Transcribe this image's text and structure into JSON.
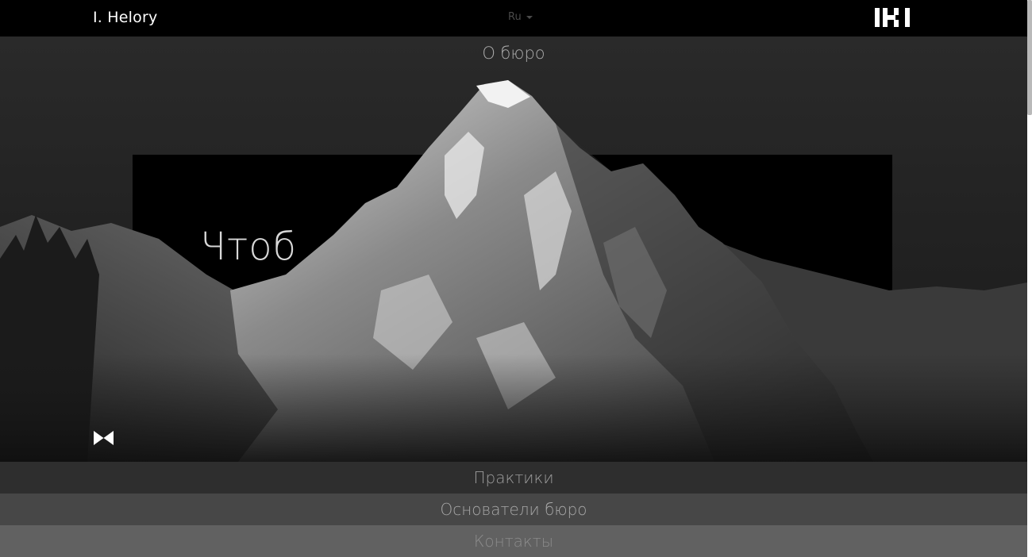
{
  "header": {
    "brand": "I. Helory",
    "language": "Ru",
    "logo_icon": "ihi-monogram-icon"
  },
  "hero": {
    "section_title": "О бюро",
    "overlay_text": "Чтоб",
    "play_icon": "bowtie-play-icon"
  },
  "sections": [
    {
      "label": "Практики"
    },
    {
      "label": "Основатели бюро"
    },
    {
      "label": "Контакты"
    }
  ],
  "colors": {
    "topbar": "#000000",
    "section_bar_1": "#2e2e2e",
    "section_bar_2": "#474747",
    "section_bar_3": "#616161"
  }
}
